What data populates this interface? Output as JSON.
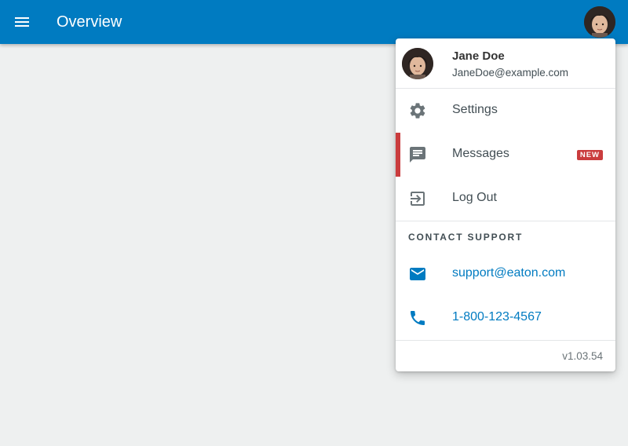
{
  "appbar": {
    "title": "Overview",
    "menu_icon": "hamburger-menu-icon",
    "background_color": "#007bc1"
  },
  "user": {
    "name": "Jane Doe",
    "email": "JaneDoe@example.com",
    "avatar_icon": "user-avatar"
  },
  "menu": {
    "items": [
      {
        "label": "Settings",
        "icon": "gear-icon"
      },
      {
        "label": "Messages",
        "icon": "message-icon",
        "badge": "NEW",
        "active": true
      },
      {
        "label": "Log Out",
        "icon": "logout-icon"
      }
    ],
    "support": {
      "title": "CONTACT SUPPORT",
      "email": "support@eaton.com",
      "phone": "1-800-123-4567"
    },
    "version": "v1.03.54"
  },
  "colors": {
    "primary": "#007bc1",
    "accent_red": "#ca3c3d",
    "background": "#eef0f0"
  }
}
